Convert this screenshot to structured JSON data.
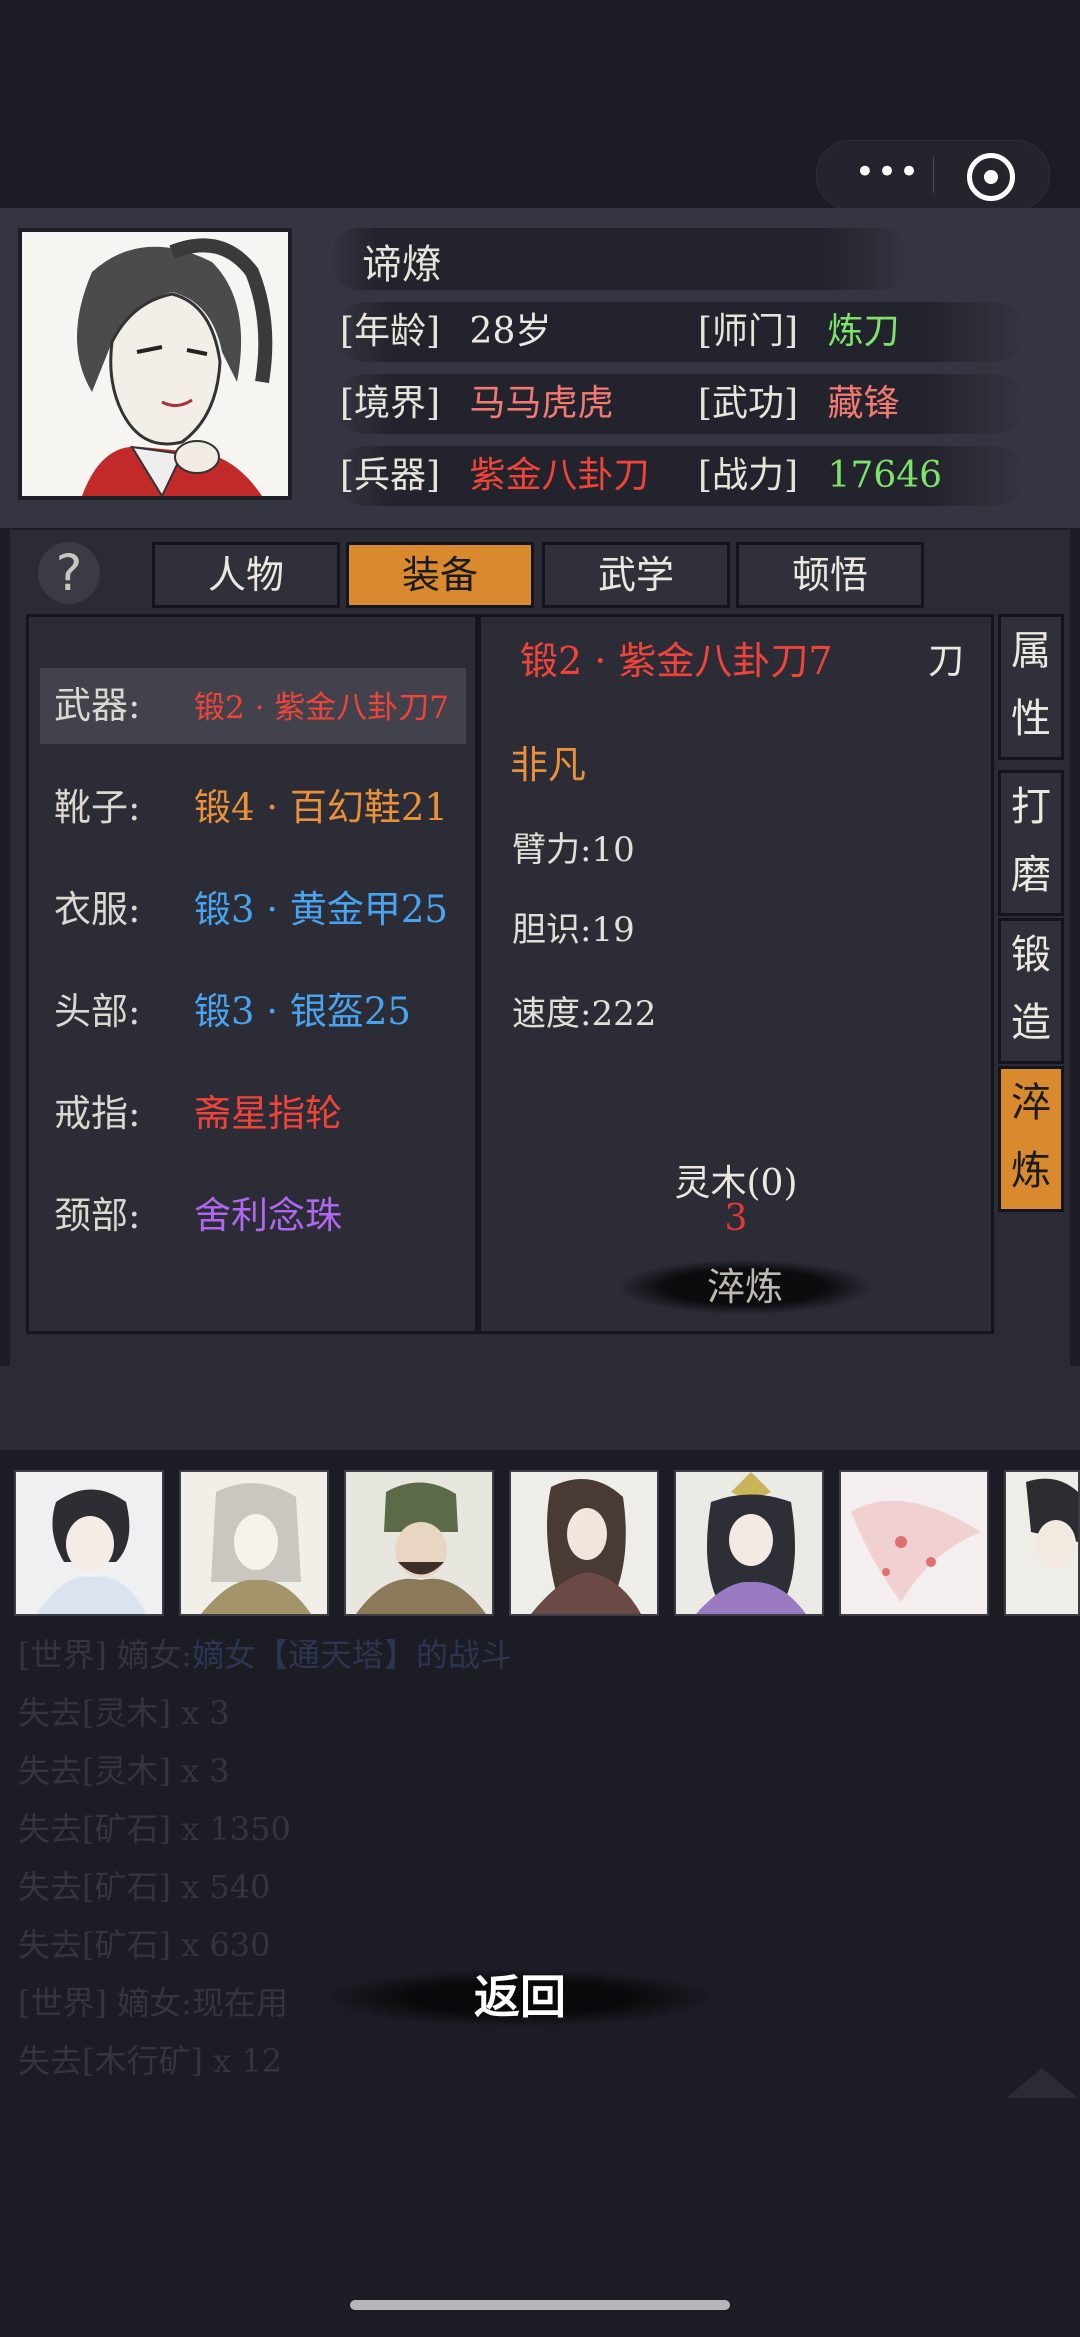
{
  "character": {
    "name": "谛燎",
    "age_label": "[年龄]",
    "age": "28岁",
    "school_label": "[师门]",
    "school": "炼刀",
    "realm_label": "[境界]",
    "realm": "马马虎虎",
    "martial_label": "[武功]",
    "martial": "藏锋",
    "weapon_label": "[兵器]",
    "weapon": "紫金八卦刀",
    "power_label": "[战力]",
    "power": "17646"
  },
  "tabs": [
    "人物",
    "装备",
    "武学",
    "顿悟"
  ],
  "active_tab": "装备",
  "help_glyph": "?",
  "equipment": [
    {
      "slot": "武器:",
      "item": "锻2 · 紫金八卦刀7",
      "color": "#f0443a"
    },
    {
      "slot": "靴子:",
      "item": "锻4 · 百幻鞋21",
      "color": "#e8903a"
    },
    {
      "slot": "衣服:",
      "item": "锻3 · 黄金甲25",
      "color": "#4aa3ee"
    },
    {
      "slot": "头部:",
      "item": "锻3 · 银盔25",
      "color": "#4aa3ee"
    },
    {
      "slot": "戒指:",
      "item": "斋星指轮",
      "color": "#f0443a"
    },
    {
      "slot": "颈部:",
      "item": "舍利念珠",
      "color": "#b166f0"
    }
  ],
  "detail": {
    "title": "锻2 · 紫金八卦刀7",
    "type": "刀",
    "quality": "非凡",
    "stats": [
      "臂力:10",
      "胆识:19",
      "速度:222"
    ],
    "material": "灵木(0)",
    "cost": "3",
    "action": "淬炼"
  },
  "side_tabs": [
    [
      "属",
      "性"
    ],
    [
      "打",
      "磨"
    ],
    [
      "锻",
      "造"
    ],
    [
      "淬",
      "炼"
    ]
  ],
  "log": [
    {
      "prefix": "[世界] 嫡女:",
      "text": "嫡女【通天塔】的战斗"
    },
    {
      "prefix": "失去",
      "text": "[灵木] x 3"
    },
    {
      "prefix": "失去",
      "text": "[灵木] x 3"
    },
    {
      "prefix": "失去",
      "text": "[矿石] x 1350"
    },
    {
      "prefix": "失去",
      "text": "[矿石] x 540"
    },
    {
      "prefix": "失去",
      "text": "[矿石] x 630"
    },
    {
      "prefix": "[世界] 嫡女:",
      "text": "现在用"
    },
    {
      "prefix": "失去",
      "text": "[木行矿] x 12"
    }
  ],
  "back_label": "返回",
  "colors": {
    "accent": "#d98a2e",
    "panel": "#2b2c36",
    "background": "#1b1c24"
  }
}
